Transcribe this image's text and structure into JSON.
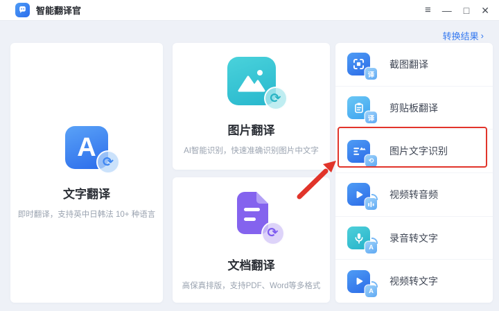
{
  "titlebar": {
    "app_name": "智能翻译官",
    "controls": {
      "menu": "≡",
      "minimize": "—",
      "maximize": "□",
      "close": "✕"
    }
  },
  "header": {
    "results_label": "转换结果",
    "results_chevron": "›"
  },
  "cards": {
    "text": {
      "icon_letter": "A",
      "title": "文字翻译",
      "subtitle": "即时翻译，支持英中日韩法 10+ 种语言"
    },
    "image": {
      "title": "图片翻译",
      "subtitle": "AI智能识别，快速准确识别图片中文字"
    },
    "document": {
      "title": "文档翻译",
      "subtitle": "高保真排版，支持PDF、Word等多格式"
    }
  },
  "sync_glyph": "⟳",
  "tools": {
    "items": [
      {
        "label": "截图翻译",
        "badge_text": "译"
      },
      {
        "label": "剪贴板翻译",
        "badge_text": "译"
      },
      {
        "label": "图片文字识别",
        "badge_text": "⟲",
        "highlighted": true
      },
      {
        "label": "视频转音频",
        "badge_text": ""
      },
      {
        "label": "录音转文字",
        "badge_text": "A"
      },
      {
        "label": "视频转文字",
        "badge_text": "A"
      }
    ]
  },
  "colors": {
    "accent_blue": "#3579f0",
    "highlight_red": "#e1342a",
    "teal": "#35c3d2",
    "purple": "#8565ec"
  }
}
